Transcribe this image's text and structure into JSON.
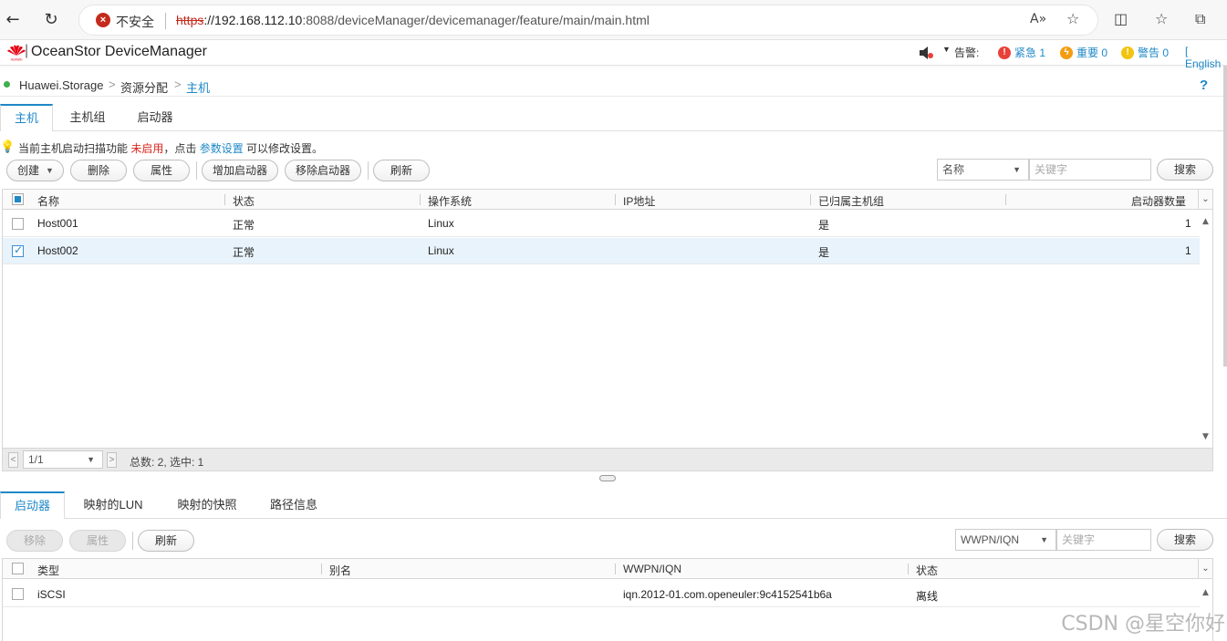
{
  "browser": {
    "insecure_label": "不安全",
    "url_proto": "https",
    "url_host": "://192.168.112.10",
    "url_rest": ":8088/deviceManager/devicemanager/feature/main/main.html"
  },
  "header": {
    "app_title": "OceanStor DeviceManager",
    "alarm_label": "告警:",
    "critical": "紧急 1",
    "major": "重要 0",
    "warning": "警告 0",
    "language": "[ English"
  },
  "breadcrumb": {
    "root": "Huawei.Storage",
    "level1": "资源分配",
    "level2": "主机"
  },
  "top_tabs": [
    "主机",
    "主机组",
    "启动器"
  ],
  "tip": {
    "prefix": "当前主机启动扫描功能 ",
    "status": "未启用",
    "middle": "，点击 ",
    "link": "参数设置",
    "suffix": " 可以修改设置。"
  },
  "host_toolbar": {
    "create": "创建",
    "delete": "删除",
    "properties": "属性",
    "add_initiator": "增加启动器",
    "remove_initiator": "移除启动器",
    "refresh": "刷新",
    "filter_field": "名称",
    "keyword_placeholder": "关键字",
    "search": "搜索"
  },
  "host_table": {
    "columns": [
      "名称",
      "状态",
      "操作系统",
      "IP地址",
      "已归属主机组",
      "启动器数量"
    ],
    "rows": [
      {
        "name": "Host001",
        "status": "正常",
        "os": "Linux",
        "ip": "",
        "in_group": "是",
        "initiators": "1",
        "checked": false
      },
      {
        "name": "Host002",
        "status": "正常",
        "os": "Linux",
        "ip": "",
        "in_group": "是",
        "initiators": "1",
        "checked": true
      }
    ]
  },
  "pager": {
    "page": "1/1",
    "summary": "总数: 2, 选中: 1"
  },
  "bottom_tabs": [
    "启动器",
    "映射的LUN",
    "映射的快照",
    "路径信息"
  ],
  "init_toolbar": {
    "remove": "移除",
    "properties": "属性",
    "refresh": "刷新",
    "filter_field": "WWPN/IQN",
    "keyword_placeholder": "关键字",
    "search": "搜索"
  },
  "init_table": {
    "columns": [
      "类型",
      "别名",
      "WWPN/IQN",
      "状态"
    ],
    "rows": [
      {
        "type": "iSCSI",
        "alias": "",
        "iqn": "iqn.2012-01.com.openeuler:9c4152541b6a",
        "status": "离线"
      }
    ]
  },
  "watermark": "CSDN @星空你好",
  "colors": {
    "accent": "#1e88c7",
    "critical": "#e8413a",
    "major": "#f39c12",
    "warning": "#f1c40f",
    "status_ok": "#3db04b"
  }
}
